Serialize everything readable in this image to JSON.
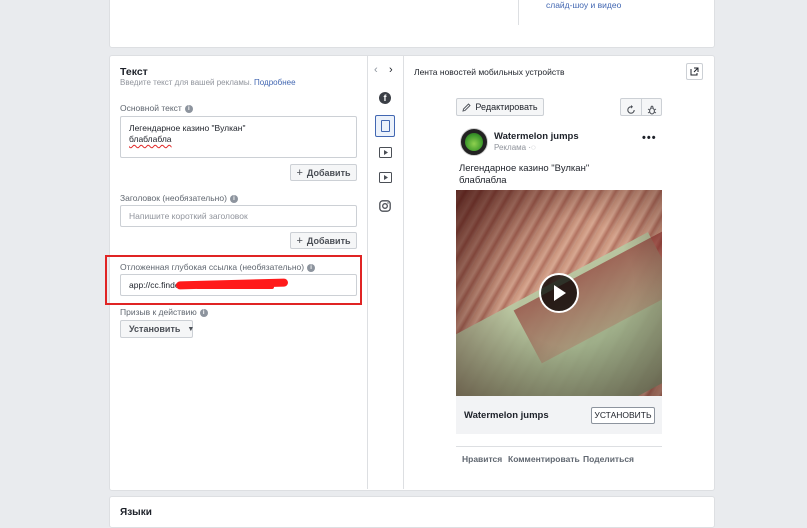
{
  "top_card": {
    "snippet": "слайд-шоу и видео"
  },
  "text_section": {
    "title": "Текст",
    "subtitle": "Введите текст для вашей рекламы.",
    "learn_more": "Подробнее",
    "primary_text": {
      "label": "Основной текст",
      "line1": "Легендарное казино \"Вулкан\"",
      "line2": "блаблабла",
      "add_label": "Добавить"
    },
    "headline": {
      "label": "Заголовок",
      "optional": "(необязательно)",
      "placeholder": "Напишите короткий заголовок",
      "add_label": "Добавить"
    },
    "deep_link": {
      "label": "Отложенная глубокая ссылка",
      "optional": "(необязательно)",
      "value": "app://cc.finder"
    },
    "cta": {
      "label": "Призыв к действию",
      "value": "Установить"
    }
  },
  "preview": {
    "placement": "Лента новостей мобильных устройств",
    "edit_label": "Редактировать",
    "page_name": "Watermelon jumps",
    "sponsored": "Реклама",
    "post_text_line1": "Легендарное казино \"Вулкан\"",
    "post_text_line2": "блаблабла",
    "footer_name": "Watermelon jumps",
    "install_label": "УСТАНОВИТЬ",
    "actions": [
      "Нравится",
      "Комментировать",
      "Поделиться"
    ]
  },
  "languages_section": {
    "title": "Языки"
  },
  "colors": {
    "accent": "#4267b2",
    "highlight": "#e02424",
    "redaction": "#ff1a1a"
  }
}
